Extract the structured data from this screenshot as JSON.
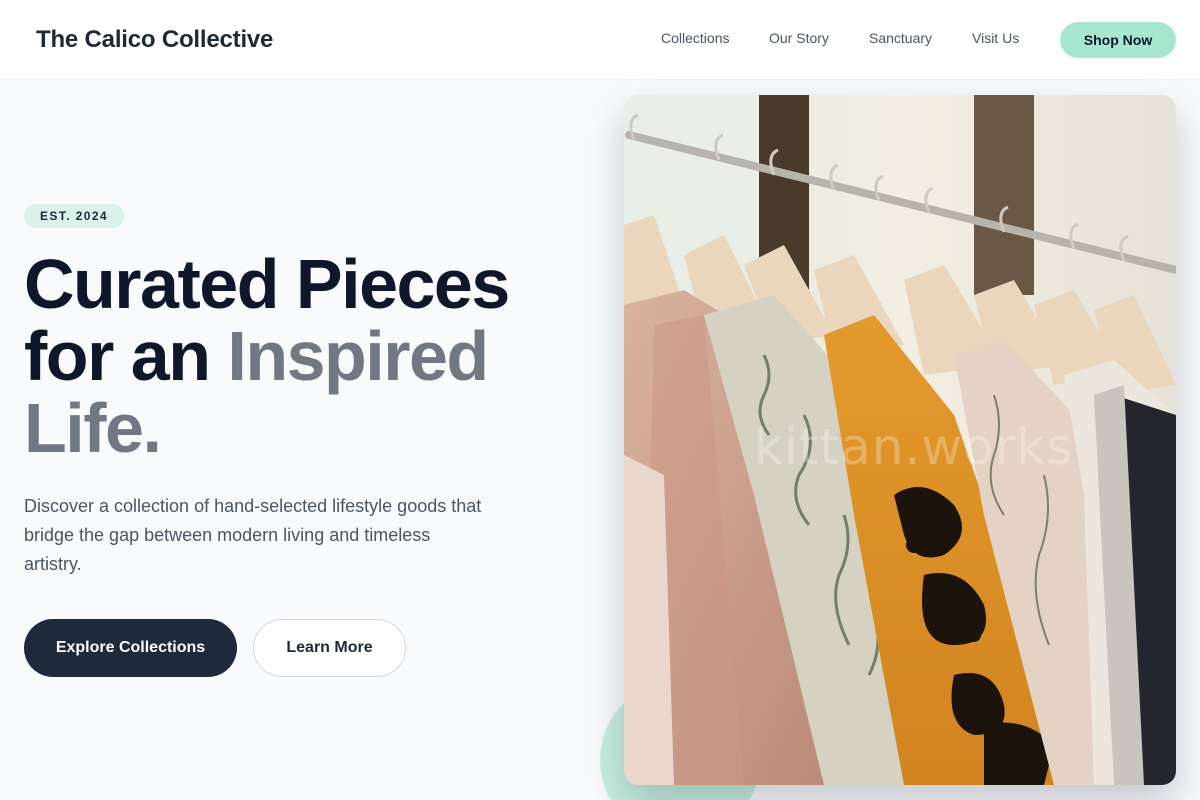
{
  "header": {
    "brand": "The Calico Collective",
    "nav": [
      {
        "label": "Collections"
      },
      {
        "label": "Our Story"
      },
      {
        "label": "Sanctuary"
      },
      {
        "label": "Visit Us"
      }
    ],
    "cta_label": "Shop Now"
  },
  "hero": {
    "badge": "EST. 2024",
    "headline": {
      "line1": "Curated Pieces",
      "line2_dark": "for an ",
      "line2_muted": "Inspired",
      "line3": "Life."
    },
    "description": "Discover a collection of hand-selected lifestyle goods that bridge the gap between modern living and timeless artistry.",
    "primary_button": "Explore Collections",
    "secondary_button": "Learn More",
    "image_watermark": "kittan.works"
  },
  "colors": {
    "accent": "#a7e6cf",
    "badge_bg": "#d9f2ea",
    "primary_button": "#1e293b",
    "headline_dark": "#0f172a",
    "headline_muted": "#727883"
  }
}
